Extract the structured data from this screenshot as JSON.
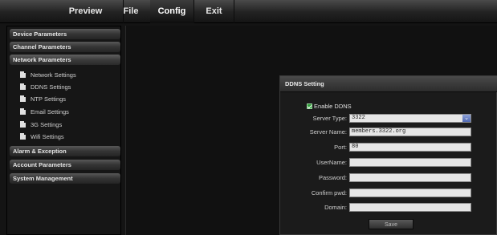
{
  "topbar": {
    "tabs": [
      {
        "label": "Preview"
      },
      {
        "label": "File"
      },
      {
        "label": "Config",
        "active": true
      },
      {
        "label": "Exit"
      }
    ]
  },
  "sidebar": {
    "groups": {
      "device": "Device Parameters",
      "channel": "Channel Parameters",
      "network": "Network Parameters",
      "alarm": "Alarm & Exception",
      "account": "Account Parameters",
      "system": "System Management"
    },
    "network_items": [
      {
        "label": "Network Settings",
        "icon": "document-icon"
      },
      {
        "label": "DDNS Settings",
        "icon": "document-icon"
      },
      {
        "label": "NTP Settings",
        "icon": "document-icon"
      },
      {
        "label": "Email Settings",
        "icon": "document-icon"
      },
      {
        "label": "3G Settings",
        "icon": "document-icon"
      },
      {
        "label": "Wifi Settings",
        "icon": "document-icon"
      }
    ]
  },
  "ddns": {
    "title": "DDNS Setting",
    "enable_label": "Enable DDNS",
    "enabled": true,
    "fields": {
      "server_type": {
        "label": "Server Type:",
        "value": "3322"
      },
      "server_name": {
        "label": "Server Name:",
        "value": "members.3322.org"
      },
      "port": {
        "label": "Port:",
        "value": "80"
      },
      "username": {
        "label": "UserName:",
        "value": ""
      },
      "password": {
        "label": "Password:",
        "value": ""
      },
      "confirm_pwd": {
        "label": "Confirm pwd:",
        "value": ""
      },
      "domain": {
        "label": "Domain:",
        "value": ""
      }
    },
    "save_label": "Save"
  },
  "colors": {
    "checkbox": "#2e9d38",
    "select_arrow": "#4f68b3"
  }
}
